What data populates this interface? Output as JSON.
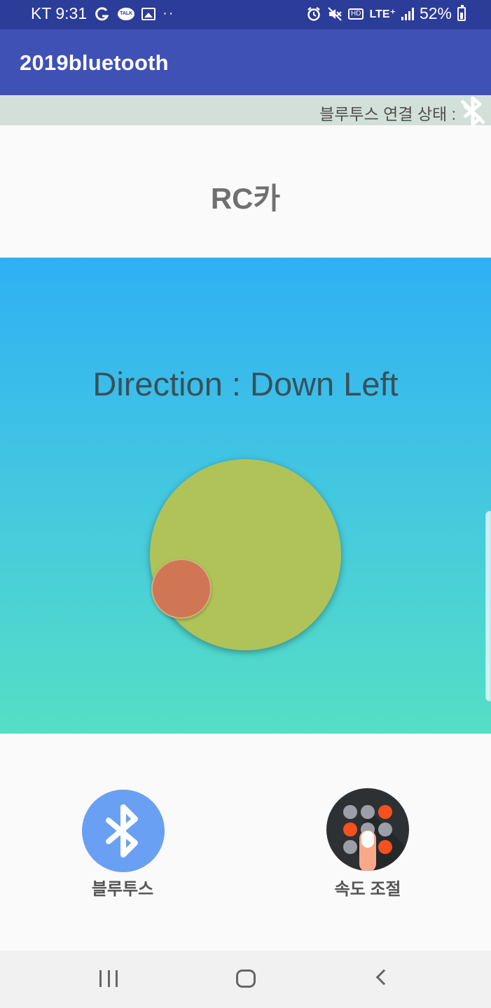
{
  "status_bar": {
    "carrier_time": "KT 9:31",
    "talk_badge": "TALK",
    "dots": "··",
    "hd": "HD",
    "lte": "LTE⁺",
    "battery": "52%"
  },
  "app_bar": {
    "title": "2019bluetooth"
  },
  "bt_status": {
    "label": "블루투스 연결 상태 :",
    "state_icon": "bluetooth-disabled-icon"
  },
  "main": {
    "title": "RC카"
  },
  "joystick": {
    "direction_text": "Direction : Down Left",
    "direction": "Down Left"
  },
  "buttons": {
    "bluetooth": {
      "label": "블루투스",
      "icon": "bluetooth-icon",
      "color": "#6aa0f3"
    },
    "speed": {
      "label": "속도 조절",
      "icon": "speed-keypad-icon",
      "accent": "#f4511e"
    }
  },
  "colors": {
    "status_bar": "#2c3c99",
    "app_bar": "#3f51b5",
    "bt_strip": "#d3e0da",
    "gradient_top": "#2fb0f4",
    "gradient_bottom": "#55dfc4",
    "joystick_base": "#b0c358",
    "joystick_knob": "#d17654"
  },
  "nav_bar": {
    "recents_icon": "recents-icon",
    "home_icon": "home-icon",
    "back_icon": "back-icon"
  }
}
